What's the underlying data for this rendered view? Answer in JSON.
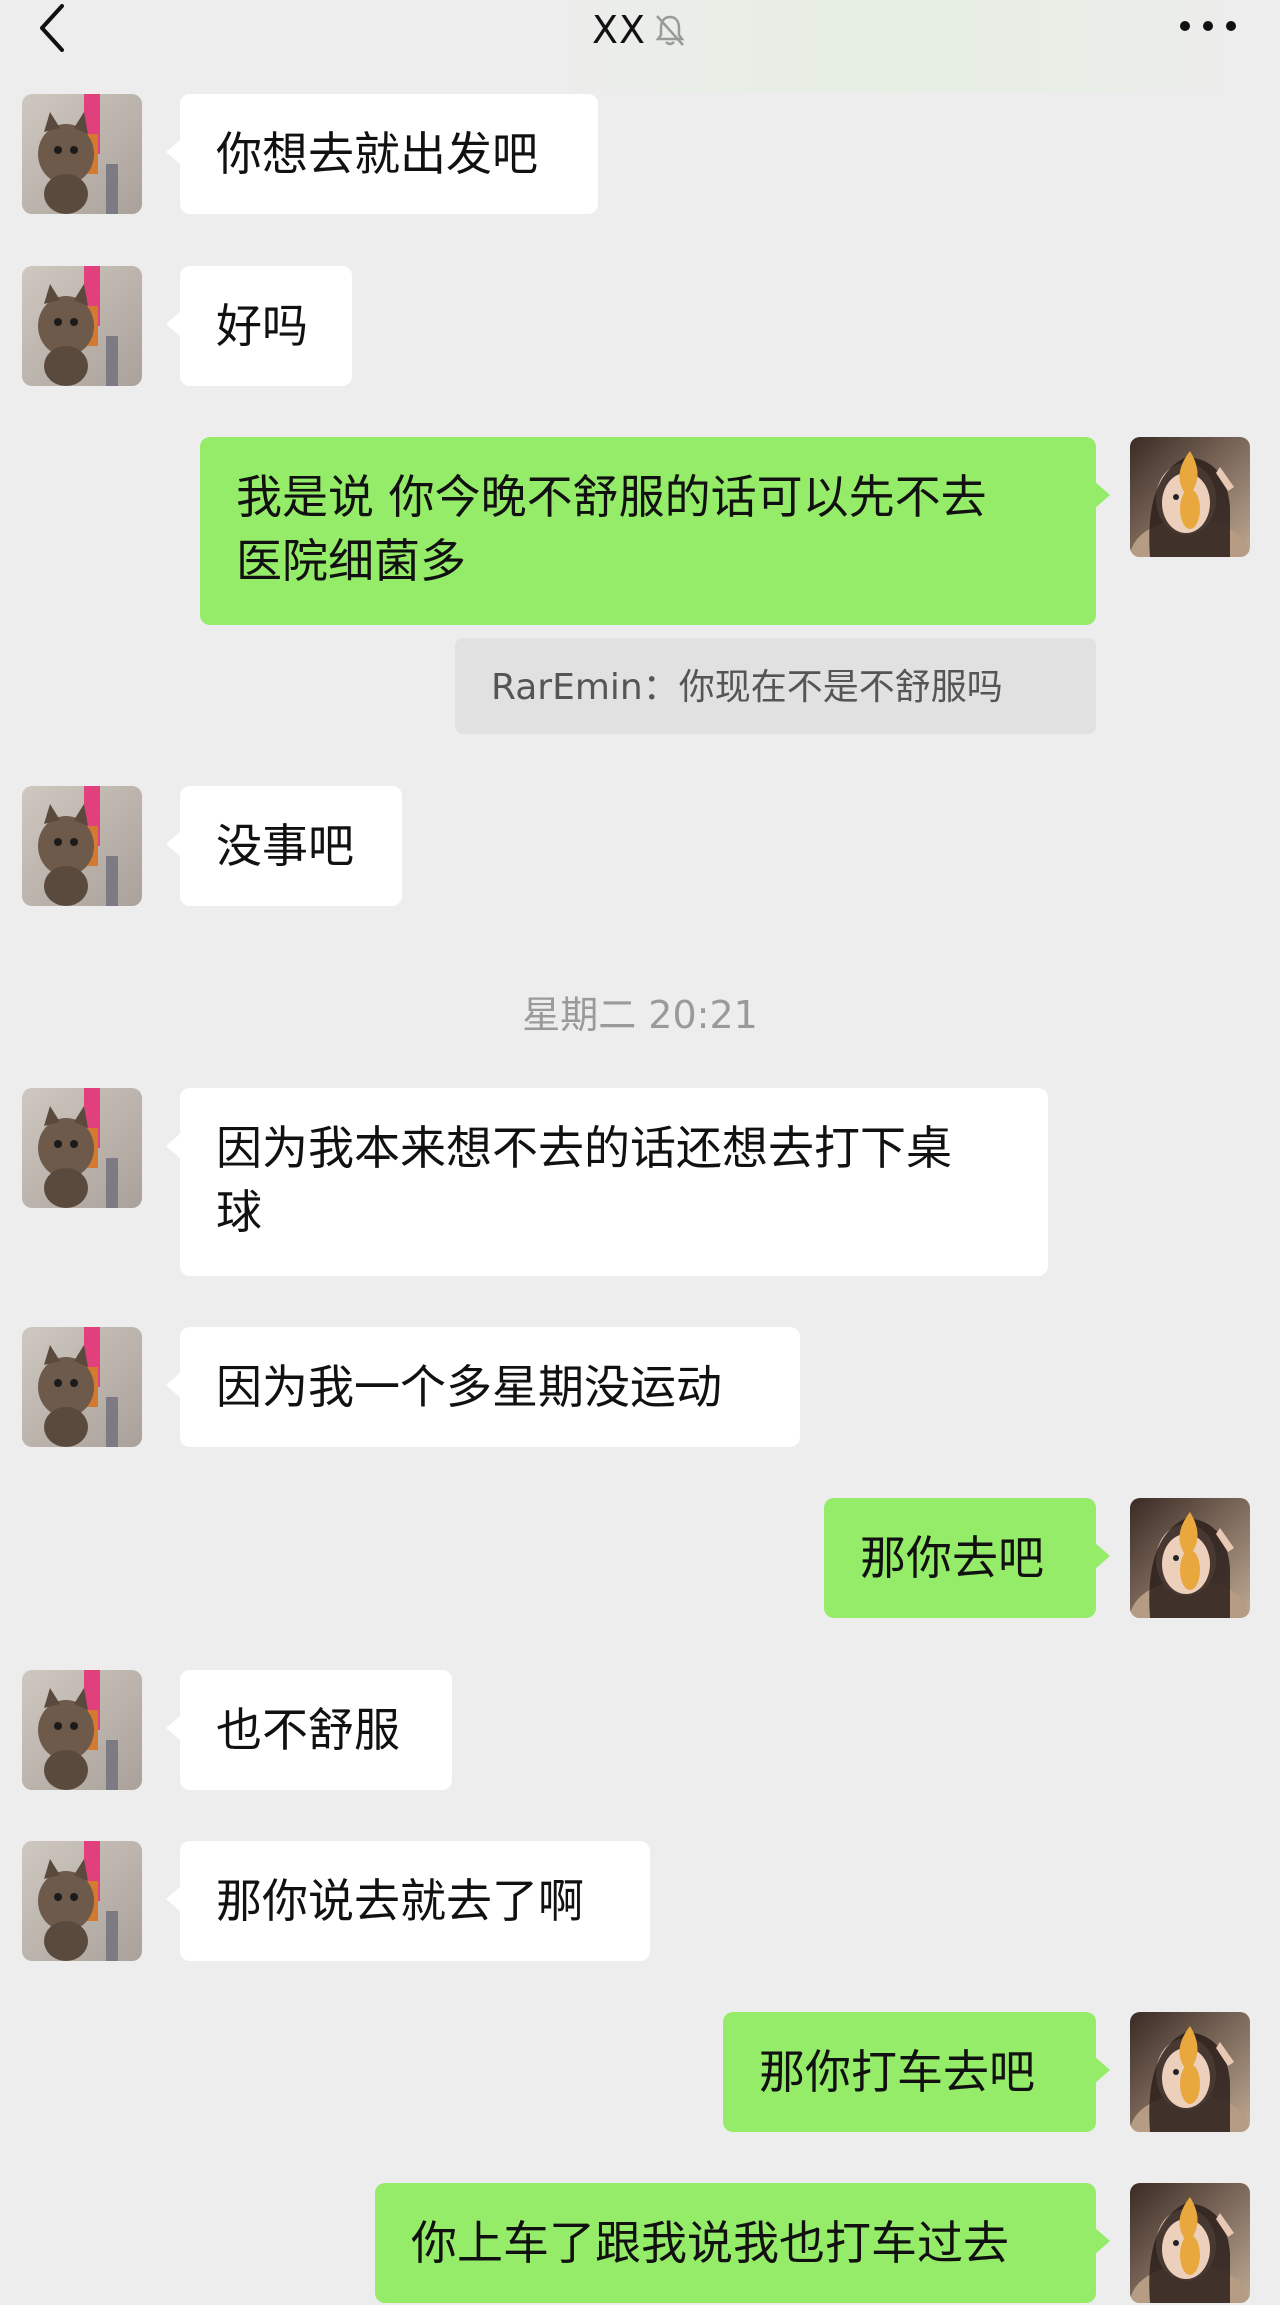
{
  "header": {
    "title": "XX",
    "icons": {
      "back": "chevron-left-icon",
      "mute": "bell-off-icon",
      "more": "more-icon"
    }
  },
  "messages": [
    {
      "side": "in",
      "text": "你想去就出发吧"
    },
    {
      "side": "in",
      "text": "好吗"
    },
    {
      "side": "out",
      "text": "我是说 你今晚不舒服的话可以先不去\n医院细菌多",
      "quote": "RarEmin：你现在不是不舒服吗"
    },
    {
      "side": "in",
      "text": "没事吧"
    },
    {
      "side": "in",
      "text": "因为我本来想不去的话还想去打下桌\n球"
    },
    {
      "side": "in",
      "text": "因为我一个多星期没运动"
    },
    {
      "side": "out",
      "text": "那你去吧"
    },
    {
      "side": "in",
      "text": "也不舒服"
    },
    {
      "side": "in",
      "text": "那你说去就去了啊"
    },
    {
      "side": "out",
      "text": "那你打车去吧"
    },
    {
      "side": "out",
      "text": "你上车了跟我说我也打车过去"
    }
  ],
  "timestamp": "星期二 20:21",
  "colors": {
    "background": "#ededed",
    "incoming_bubble": "#ffffff",
    "outgoing_bubble": "#95ec69",
    "quote_bg": "#e1e1e1"
  }
}
